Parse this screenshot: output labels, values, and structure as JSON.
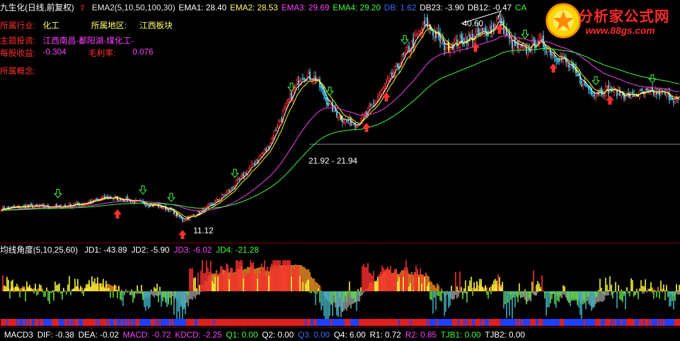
{
  "header": {
    "title": "九生化(日线,前复权)",
    "indicators": [
      {
        "text": "EMA2(5,10,50,100,30)",
        "color": "#e8e8e8"
      },
      {
        "text": "EMA1: 28.40",
        "color": "#ffffff"
      },
      {
        "text": "EMA2: 28.53",
        "color": "#ffff66"
      },
      {
        "text": "EMA3: 29.69",
        "color": "#ff40ff"
      },
      {
        "text": "EMA4: 29.20",
        "color": "#40ff40"
      },
      {
        "text": "DB: 1.62",
        "color": "#3b6cff"
      },
      {
        "text": "DB23: -3.90",
        "color": "#ffffff"
      },
      {
        "text": "DB12: -0.47",
        "color": "#ffffff"
      },
      {
        "text": "CA",
        "color": "#40ff40"
      }
    ]
  },
  "info": {
    "industry_label": "所属行业:",
    "industry_value": "化工",
    "region_label": "所属地区:",
    "region_value": "江西板块",
    "theme_label": "主题投资:",
    "theme_value": "江西南昌-鄱阳湖-煤化工-",
    "eps_label": "每股收益:",
    "eps_value": "-0.304",
    "gross_label": "毛利率:",
    "gross_value": "0.076",
    "concept_label": "所属概念:"
  },
  "watermark": {
    "title": "分析家公式网",
    "url": "www.88gs.com"
  },
  "annotations": {
    "high": "40.60",
    "mid": "21.92 - 21.94",
    "low": "11.12"
  },
  "sub1": {
    "title": "均线角度(5,10,25,60)",
    "items": [
      {
        "text": "JD1: -43.89",
        "color": "#ffffff"
      },
      {
        "text": "JD2: -5.90",
        "color": "#ffffff"
      },
      {
        "text": "JD3: -6.02",
        "color": "#ff40ff"
      },
      {
        "text": "JD4: -21.28",
        "color": "#40ff40"
      }
    ]
  },
  "sub2": {
    "items": [
      {
        "text": "MACD3",
        "color": "#ffffff"
      },
      {
        "text": "DIF: -0.38",
        "color": "#ffffff"
      },
      {
        "text": "DEA: -0.02",
        "color": "#ffffff"
      },
      {
        "text": "MACD: -0.72",
        "color": "#ff40ff"
      },
      {
        "text": "KDCD: -2.25",
        "color": "#ff40ff"
      },
      {
        "text": "Q1: 0.00",
        "color": "#40ff40"
      },
      {
        "text": "Q2: 0.00",
        "color": "#ffffff"
      },
      {
        "text": "Q3: 0.00",
        "color": "#3b6cff"
      },
      {
        "text": "Q4: 6.00",
        "color": "#ffffff"
      },
      {
        "text": "R1: 0.72",
        "color": "#ffffff"
      },
      {
        "text": "R2: 0.85",
        "color": "#ff40ff"
      },
      {
        "text": "TJB1: 0.00",
        "color": "#40ff40"
      },
      {
        "text": "TJB2: 0.00",
        "color": "#ffffff"
      }
    ]
  },
  "chart_data": {
    "type": "candlestick",
    "price_waypoints": [
      [
        0,
        12.8
      ],
      [
        20,
        13.1
      ],
      [
        40,
        13.0
      ],
      [
        60,
        13.6
      ],
      [
        75,
        14.4
      ],
      [
        90,
        14.0
      ],
      [
        100,
        13.5
      ],
      [
        110,
        13.2
      ],
      [
        120,
        12.5
      ],
      [
        128,
        11.12
      ],
      [
        138,
        12.0
      ],
      [
        150,
        13.5
      ],
      [
        162,
        15.5
      ],
      [
        175,
        18.5
      ],
      [
        188,
        21.5
      ],
      [
        200,
        27.0
      ],
      [
        212,
        32.0
      ],
      [
        222,
        31.5
      ],
      [
        232,
        27.5
      ],
      [
        242,
        25.5
      ],
      [
        252,
        25.0
      ],
      [
        262,
        27.5
      ],
      [
        272,
        30.5
      ],
      [
        282,
        34.0
      ],
      [
        292,
        37.0
      ],
      [
        300,
        39.5
      ],
      [
        306,
        38.0
      ],
      [
        314,
        36.0
      ],
      [
        324,
        36.8
      ],
      [
        334,
        37.5
      ],
      [
        345,
        38.5
      ],
      [
        352,
        40.0
      ],
      [
        360,
        36.5
      ],
      [
        370,
        35.5
      ],
      [
        380,
        37.0
      ],
      [
        390,
        35.0
      ],
      [
        398,
        34.0
      ],
      [
        410,
        31.0
      ],
      [
        418,
        29.5
      ],
      [
        430,
        30.0
      ],
      [
        442,
        29.0
      ],
      [
        454,
        29.3
      ],
      [
        466,
        29.5
      ],
      [
        478,
        28.4
      ]
    ],
    "ema_lines": [
      {
        "name": "EMA1",
        "color": "#ffffff",
        "period": 5
      },
      {
        "name": "EMA2",
        "color": "#ffff00",
        "period": 10
      },
      {
        "name": "EMA3",
        "color": "#ff40ff",
        "period": 50
      },
      {
        "name": "EMA4",
        "color": "#40ff40",
        "period": 100
      }
    ],
    "ref_line": 21.93
  }
}
